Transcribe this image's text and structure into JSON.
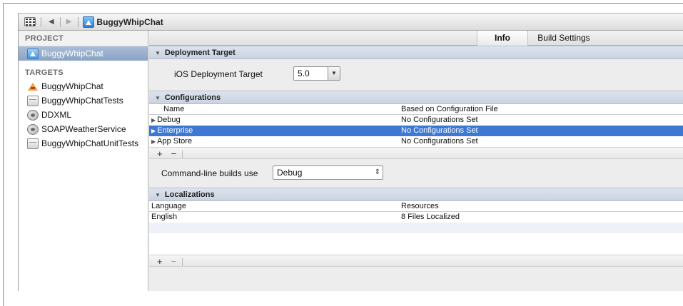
{
  "jumpbar": {
    "project_name": "BuggyWhipChat"
  },
  "navigator": {
    "project_header": "PROJECT",
    "project_item": "BuggyWhipChat",
    "targets_header": "TARGETS",
    "targets": [
      {
        "label": "BuggyWhipChat",
        "icon": "app-target-icon"
      },
      {
        "label": "BuggyWhipChatTests",
        "icon": "bundle-icon"
      },
      {
        "label": "DDXML",
        "icon": "library-icon"
      },
      {
        "label": "SOAPWeatherService",
        "icon": "library-icon"
      },
      {
        "label": "BuggyWhipChatUnitTests",
        "icon": "bundle-icon"
      }
    ]
  },
  "tabs": {
    "info": "Info",
    "build_settings": "Build Settings"
  },
  "deployment": {
    "header": "Deployment Target",
    "label": "iOS Deployment Target",
    "value": "5.0"
  },
  "configurations": {
    "header": "Configurations",
    "col_name": "Name",
    "col_file": "Based on Configuration File",
    "rows": [
      {
        "name": "Debug",
        "file": "No Configurations Set"
      },
      {
        "name": "Enterprise",
        "file": "No Configurations Set"
      },
      {
        "name": "App Store",
        "file": "No Configurations Set"
      }
    ],
    "add": "+",
    "remove": "−"
  },
  "command_line": {
    "label": "Command-line builds use",
    "value": "Debug"
  },
  "localizations": {
    "header": "Localizations",
    "col_language": "Language",
    "col_resources": "Resources",
    "rows": [
      {
        "language": "English",
        "resources": "8 Files Localized"
      }
    ],
    "add": "+",
    "remove": "−"
  },
  "colors": {
    "selection": "#3f78d3",
    "section_header": "#d3dbe6"
  }
}
